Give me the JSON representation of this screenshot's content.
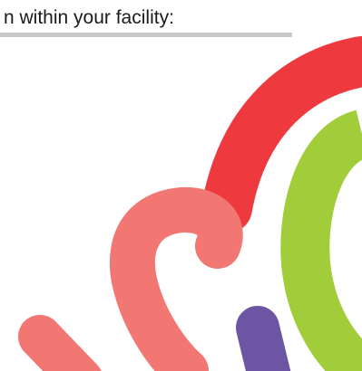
{
  "document": {
    "heading_fragment": "n within your facility:"
  },
  "logo": {
    "colors": {
      "red": "#ee3a3e",
      "green": "#a1cd3a",
      "pink": "#f27672",
      "purple": "#6e55a3",
      "underline_gray": "#c8c8c8"
    }
  }
}
